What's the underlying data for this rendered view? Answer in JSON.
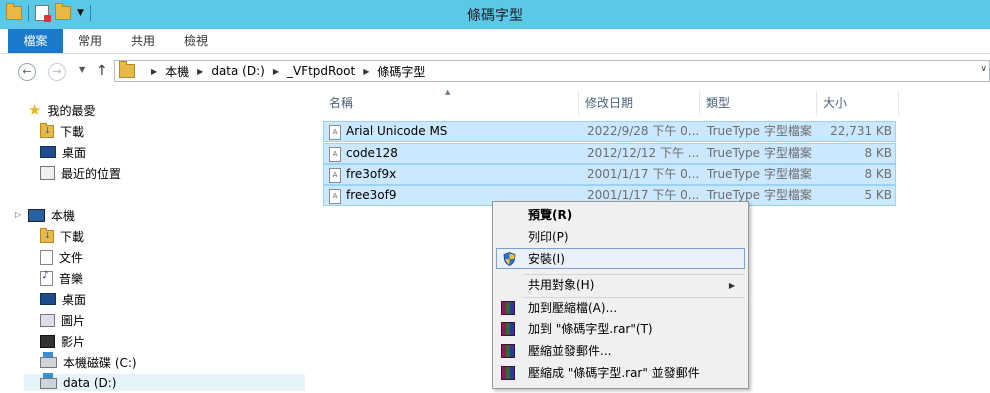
{
  "window": {
    "title": "條碼字型"
  },
  "ribbon": {
    "tabs": [
      "檔案",
      "常用",
      "共用",
      "檢視"
    ]
  },
  "address": {
    "root_icon": "folder-icon",
    "crumbs": [
      "本機",
      "data (D:)",
      "_VFtpdRoot",
      "條碼字型"
    ]
  },
  "nav": {
    "favorites": {
      "label": "我的最愛",
      "items": [
        "下載",
        "桌面",
        "最近的位置"
      ]
    },
    "computer": {
      "label": "本機",
      "items": [
        "下載",
        "文件",
        "音樂",
        "桌面",
        "圖片",
        "影片",
        "本機磁碟 (C:)",
        "data (D:)"
      ]
    }
  },
  "columns": {
    "name": "名稱",
    "modified": "修改日期",
    "type": "類型",
    "size": "大小"
  },
  "files": [
    {
      "name": "Arial Unicode MS",
      "modified": "2022/9/28 下午 0...",
      "type": "TrueType 字型檔案",
      "size": "22,731 KB"
    },
    {
      "name": "code128",
      "modified": "2012/12/12 下午 ...",
      "type": "TrueType 字型檔案",
      "size": "8 KB"
    },
    {
      "name": "fre3of9x",
      "modified": "2001/1/17 下午 0...",
      "type": "TrueType 字型檔案",
      "size": "8 KB"
    },
    {
      "name": "free3of9",
      "modified": "2001/1/17 下午 0...",
      "type": "TrueType 字型檔案",
      "size": "5 KB"
    }
  ],
  "context_menu": {
    "items": [
      "預覽(R)",
      "列印(P)",
      "安裝(I)",
      "共用對象(H)",
      "加到壓縮檔(A)...",
      "加到 \"條碼字型.rar\"(T)",
      "壓縮並發郵件...",
      "壓縮成 \"條碼字型.rar\" 並發郵件"
    ],
    "highlighted": "安裝(I)"
  },
  "colors": {
    "titlebar": "#5bc8e8",
    "file_tab": "#1979ca",
    "selection": "#cce8ff",
    "selection_border": "#99d1ff"
  }
}
